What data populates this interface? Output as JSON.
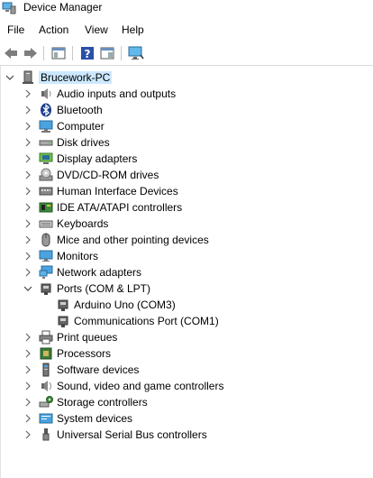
{
  "window": {
    "title": "Device Manager"
  },
  "menu": [
    "File",
    "Action",
    "View",
    "Help"
  ],
  "toolbar": {
    "buttons": [
      "back-icon",
      "forward-icon",
      "show-hide-console-tree-icon",
      "help-icon",
      "properties-icon",
      "scan-hardware-icon"
    ]
  },
  "tree": {
    "root": "Brucework-PC",
    "categories": [
      {
        "label": "Audio inputs and outputs",
        "icon": "speaker-icon"
      },
      {
        "label": "Bluetooth",
        "icon": "bluetooth-icon"
      },
      {
        "label": "Computer",
        "icon": "computer-icon"
      },
      {
        "label": "Disk drives",
        "icon": "disk-drive-icon"
      },
      {
        "label": "Display adapters",
        "icon": "display-adapter-icon"
      },
      {
        "label": "DVD/CD-ROM drives",
        "icon": "dvd-drive-icon"
      },
      {
        "label": "Human Interface Devices",
        "icon": "hid-icon"
      },
      {
        "label": "IDE ATA/ATAPI controllers",
        "icon": "ide-controller-icon"
      },
      {
        "label": "Keyboards",
        "icon": "keyboard-icon"
      },
      {
        "label": "Mice and other pointing devices",
        "icon": "mouse-icon"
      },
      {
        "label": "Monitors",
        "icon": "monitor-icon"
      },
      {
        "label": "Network adapters",
        "icon": "network-adapter-icon"
      },
      {
        "label": "Ports (COM & LPT)",
        "icon": "port-icon",
        "expanded": true,
        "children": [
          {
            "label": "Arduino Uno (COM3)",
            "icon": "port-icon"
          },
          {
            "label": "Communications Port (COM1)",
            "icon": "port-icon"
          }
        ]
      },
      {
        "label": "Print queues",
        "icon": "printer-icon"
      },
      {
        "label": "Processors",
        "icon": "processor-icon"
      },
      {
        "label": "Software devices",
        "icon": "software-device-icon"
      },
      {
        "label": "Sound, video and game controllers",
        "icon": "sound-controller-icon"
      },
      {
        "label": "Storage controllers",
        "icon": "storage-controller-icon"
      },
      {
        "label": "System devices",
        "icon": "system-device-icon"
      },
      {
        "label": "Universal Serial Bus controllers",
        "icon": "usb-icon"
      }
    ]
  }
}
